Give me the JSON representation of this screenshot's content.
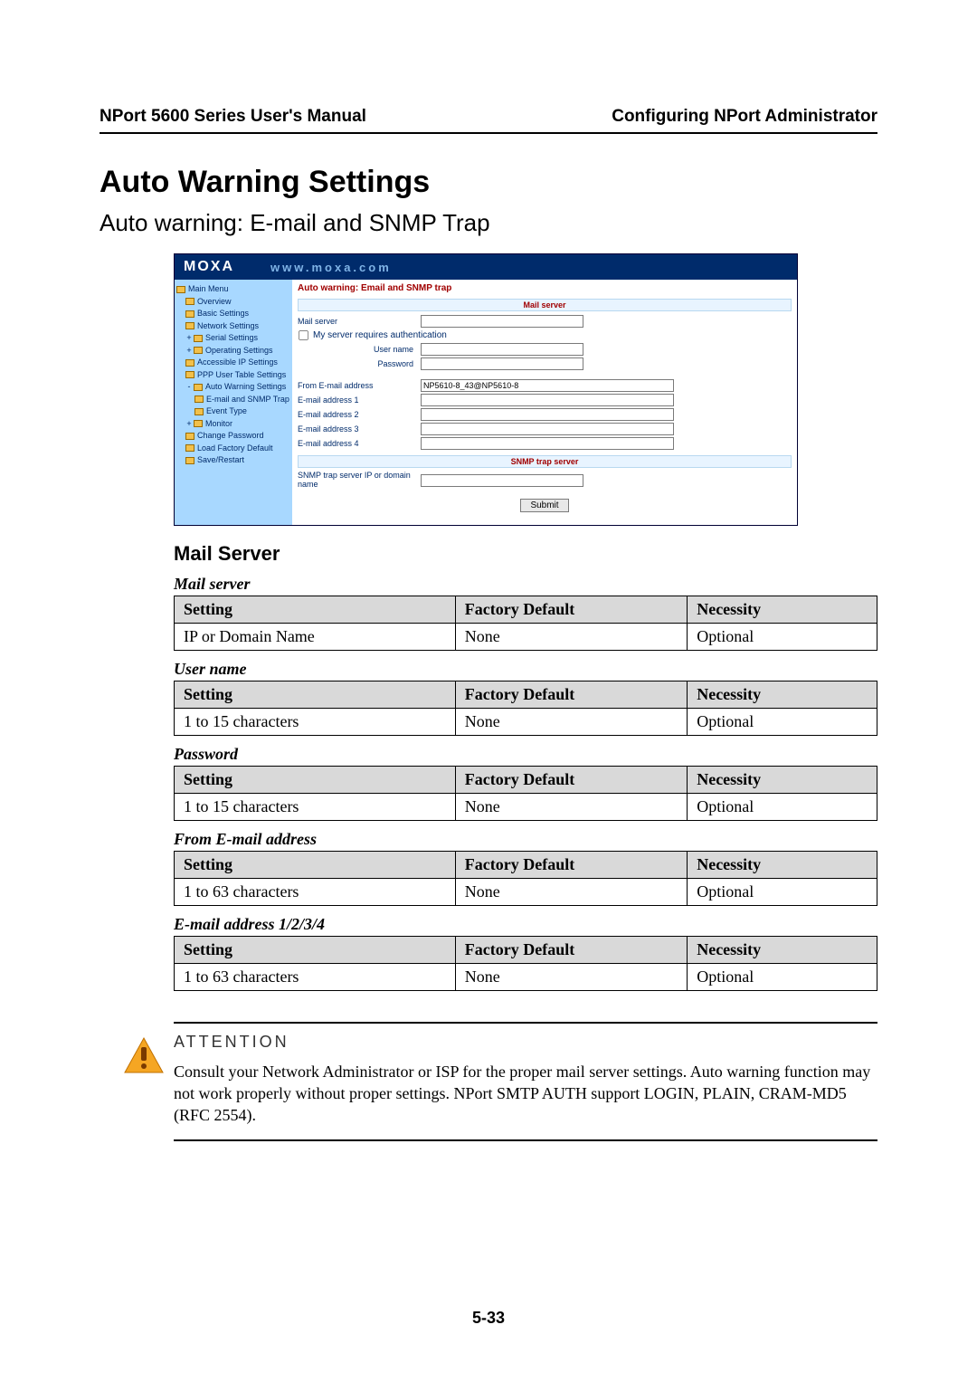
{
  "header": {
    "left": "NPort 5600 Series User's Manual",
    "right": "Configuring NPort Administrator"
  },
  "headings": {
    "h1": "Auto Warning Settings",
    "h2": "Auto warning: E-mail and SNMP Trap",
    "h3": "Mail Server"
  },
  "screenshot": {
    "logo": "MOXA",
    "url": "www.moxa.com",
    "tree": {
      "main": "Main Menu",
      "items": [
        "Overview",
        "Basic Settings",
        "Network Settings",
        "Serial Settings",
        "Operating Settings",
        "Accessible IP Settings",
        "PPP User Table Settings",
        "Auto Warning Settings",
        "E-mail and SNMP Trap",
        "Event Type",
        "Monitor",
        "Change Password",
        "Load Factory Default",
        "Save/Restart"
      ]
    },
    "panel": {
      "title": "Auto warning: Email and SNMP trap",
      "mail_header": "Mail server",
      "snmp_header": "SNMP trap server",
      "mail_server_label": "Mail server",
      "auth_label": "My server requires authentication",
      "user_label": "User name",
      "pass_label": "Password",
      "from_label": "From E-mail address",
      "from_value": "NP5610-8_43@NP5610-8",
      "e1": "E-mail address 1",
      "e2": "E-mail address 2",
      "e3": "E-mail address 3",
      "e4": "E-mail address 4",
      "snmp_label": "SNMP trap server IP or domain name",
      "submit": "Submit"
    }
  },
  "columns": {
    "setting": "Setting",
    "factory": "Factory Default",
    "necessity": "Necessity"
  },
  "tables": [
    {
      "title": "Mail server",
      "setting": "IP or Domain Name",
      "factory": "None",
      "necessity": "Optional"
    },
    {
      "title": "User name",
      "setting": "1 to 15 characters",
      "factory": "None",
      "necessity": "Optional"
    },
    {
      "title": "Password",
      "setting": "1 to 15 characters",
      "factory": "None",
      "necessity": "Optional"
    },
    {
      "title": "From E-mail address",
      "setting": "1 to 63 characters",
      "factory": "None",
      "necessity": "Optional"
    },
    {
      "title": "E-mail address 1/2/3/4",
      "setting": "1 to 63 characters",
      "factory": "None",
      "necessity": "Optional"
    }
  ],
  "attention": {
    "label": "ATTENTION",
    "body": "Consult your Network Administrator or ISP for the proper mail server settings. Auto warning function may not work properly without proper settings. NPort SMTP AUTH support LOGIN, PLAIN, CRAM-MD5 (RFC 2554)."
  },
  "page_num": "5-33"
}
